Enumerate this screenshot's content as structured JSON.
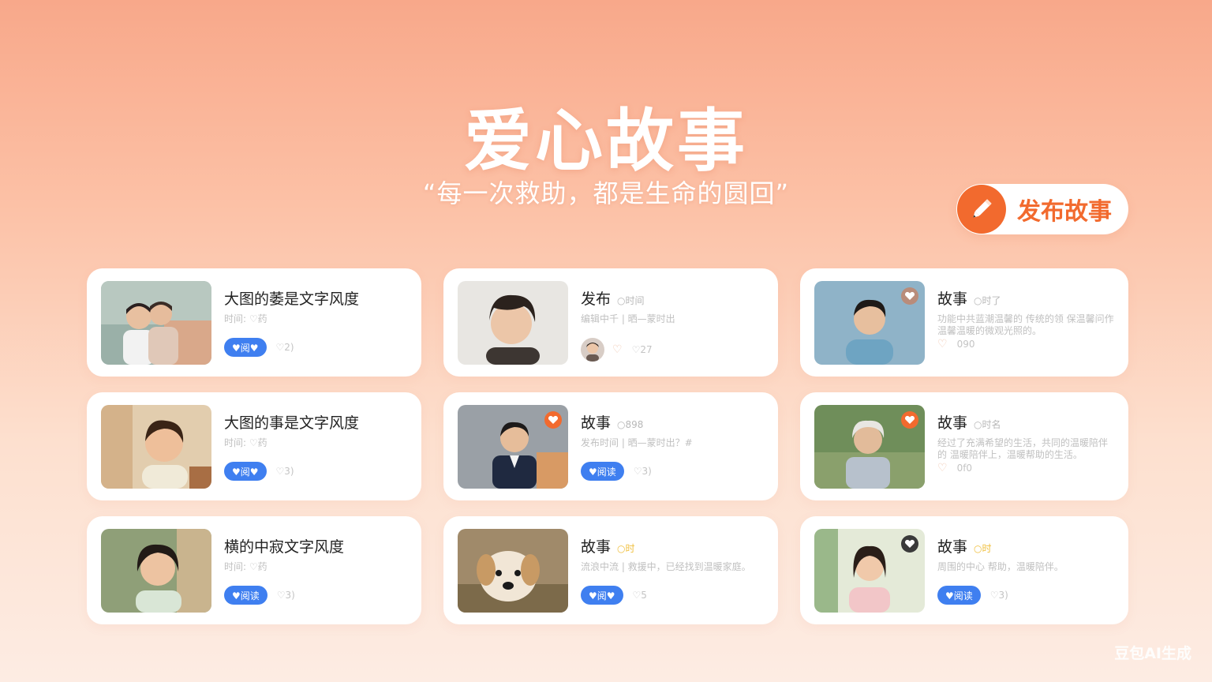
{
  "header": {
    "title": "爱心故事",
    "subtitle": "“每一次救助，都是生命的圆回”"
  },
  "publish_button": {
    "label": "发布故事",
    "icon": "pencil-icon",
    "color": "#f26a2e"
  },
  "accent_colors": {
    "brand": "#f26a2e",
    "button_blue": "#3f7ff0"
  },
  "cards": [
    {
      "title": "大图的萎是文字风度",
      "tag": "",
      "meta": "时间: ♡药",
      "action": "♥阅♥",
      "likes": "♡2)"
    },
    {
      "title": "发布",
      "tag": "○时间",
      "meta": "编辑中千 | 晒—蒙时出",
      "action": "",
      "likes": "♡27"
    },
    {
      "title": "故事",
      "tag": "○时了",
      "meta": "功能中共蓝潮温馨的 传统的领 保温馨问作 温馨温暖的微观光照的。",
      "action": "",
      "likes": "090"
    },
    {
      "title": "大图的事是文字风度",
      "tag": "",
      "meta": "时间: ♡药",
      "action": "♥阅♥",
      "likes": "♡3)"
    },
    {
      "title": "故事",
      "tag": "○898",
      "meta": "发布时间 | 晒—蒙时出？#",
      "action": "♥阅读",
      "likes": "♡3)"
    },
    {
      "title": "故事",
      "tag": "○时名",
      "meta": "经过了充满希望的生活，共同的温暖陪伴的 温暖陪伴上，温暖帮助的生活。",
      "action": "",
      "likes": "0f0"
    },
    {
      "title": "横的中寂文字风度",
      "tag": "",
      "meta": "时间: ♡药",
      "action": "♥阅读",
      "likes": "♡3)"
    },
    {
      "title": "故事",
      "tag": "○时",
      "meta": "流浪中流 | 救援中，已经找到温暖家庭。",
      "action": "♥阅♥",
      "likes": "♡5"
    },
    {
      "title": "故事",
      "tag": "○时",
      "meta": "周围的中心 帮助，温暖陪伴。",
      "action": "♥阅读",
      "likes": "♡3)"
    }
  ],
  "watermark": "豆包AI生成"
}
